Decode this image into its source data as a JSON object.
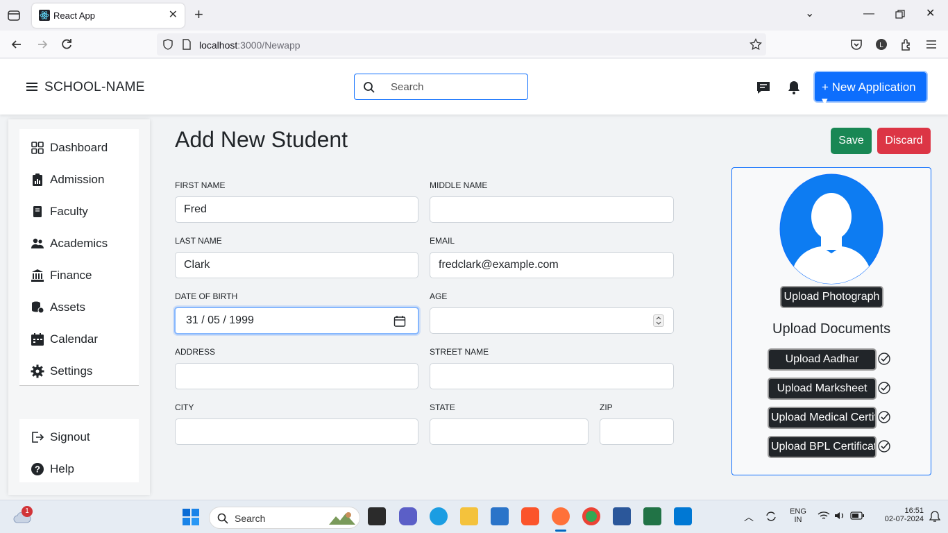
{
  "browser": {
    "tab_title": "React App",
    "url_host": "localhost",
    "url_rest": ":3000/Newapp",
    "new_tab": "+"
  },
  "header": {
    "brand": "SCHOOL-NAME",
    "search_placeholder": "Search",
    "new_application": "+ New Application ▾"
  },
  "sidebar": {
    "items": [
      {
        "label": "Dashboard",
        "icon": "grid-icon"
      },
      {
        "label": "Admission",
        "icon": "clipboard-chart-icon"
      },
      {
        "label": "Faculty",
        "icon": "book-icon"
      },
      {
        "label": "Academics",
        "icon": "people-icon"
      },
      {
        "label": "Finance",
        "icon": "bank-icon"
      },
      {
        "label": "Assets",
        "icon": "coins-icon"
      },
      {
        "label": "Calendar",
        "icon": "calendar-icon"
      },
      {
        "label": "Settings",
        "icon": "gear-icon"
      }
    ],
    "bottom": [
      {
        "label": "Signout",
        "icon": "signout-icon"
      },
      {
        "label": "Help",
        "icon": "help-icon"
      }
    ]
  },
  "page": {
    "title": "Add New Student",
    "save": "Save",
    "discard": "Discard"
  },
  "form": {
    "first_name": {
      "label": "FIRST NAME",
      "value": "Fred"
    },
    "middle_name": {
      "label": "MIDDLE NAME",
      "value": ""
    },
    "last_name": {
      "label": "LAST NAME",
      "value": "Clark"
    },
    "email": {
      "label": "EMAIL",
      "value": "fredclark@example.com"
    },
    "dob": {
      "label": "DATE OF BIRTH",
      "value": "31 / 05 / 1999"
    },
    "age": {
      "label": "AGE",
      "value": ""
    },
    "address": {
      "label": "ADDRESS",
      "value": ""
    },
    "street": {
      "label": "STREET NAME",
      "value": ""
    },
    "city": {
      "label": "CITY",
      "value": ""
    },
    "state": {
      "label": "STATE",
      "value": ""
    },
    "zip": {
      "label": "ZIP",
      "value": ""
    }
  },
  "uploads": {
    "photo": "Upload Photograph",
    "docs_title": "Upload Documents",
    "aadhar": "Upload Aadhar",
    "marksheet": "Upload Marksheet",
    "medical": "Upload Medical Certificate",
    "bpl": "Upload BPL Certificate"
  },
  "taskbar": {
    "search": "Search",
    "weather_badge": "1",
    "lang_top": "ENG",
    "lang_bottom": "IN",
    "time": "16:51",
    "date": "02-07-2024"
  },
  "colors": {
    "primary": "#0d6efd",
    "success": "#198754",
    "danger": "#dc3545",
    "dark": "#212529"
  }
}
